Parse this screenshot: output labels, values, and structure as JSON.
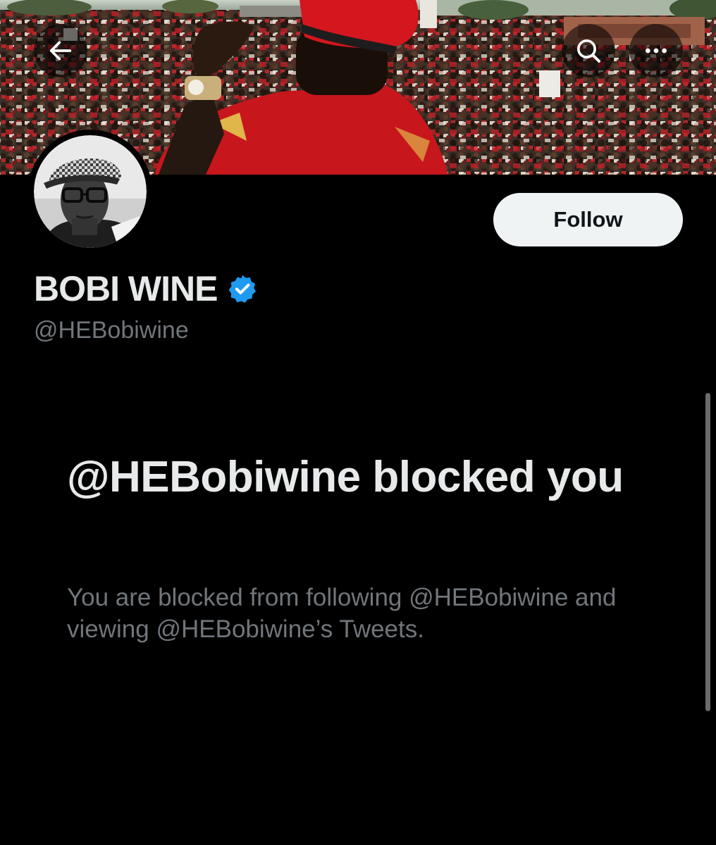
{
  "header": {
    "back_icon": "arrow-left-icon",
    "search_icon": "search-icon",
    "more_icon": "more-horizontal-icon"
  },
  "profile": {
    "display_name": "BOBI WINE",
    "handle": "@HEBobiwine",
    "verified": true,
    "verified_color": "#1d9bf0",
    "follow_label": "Follow"
  },
  "blocked": {
    "title": "@HEBobiwine blocked you",
    "message": "You are blocked from following @HEBobiwine and viewing @HEBobiwine’s Tweets."
  },
  "colors": {
    "background": "#000000",
    "primary_text": "#e7e9ea",
    "secondary_text": "#71767b",
    "follow_button_bg": "#eff3f4",
    "follow_button_text": "#0f1419",
    "accent_red": "#c8161d"
  }
}
